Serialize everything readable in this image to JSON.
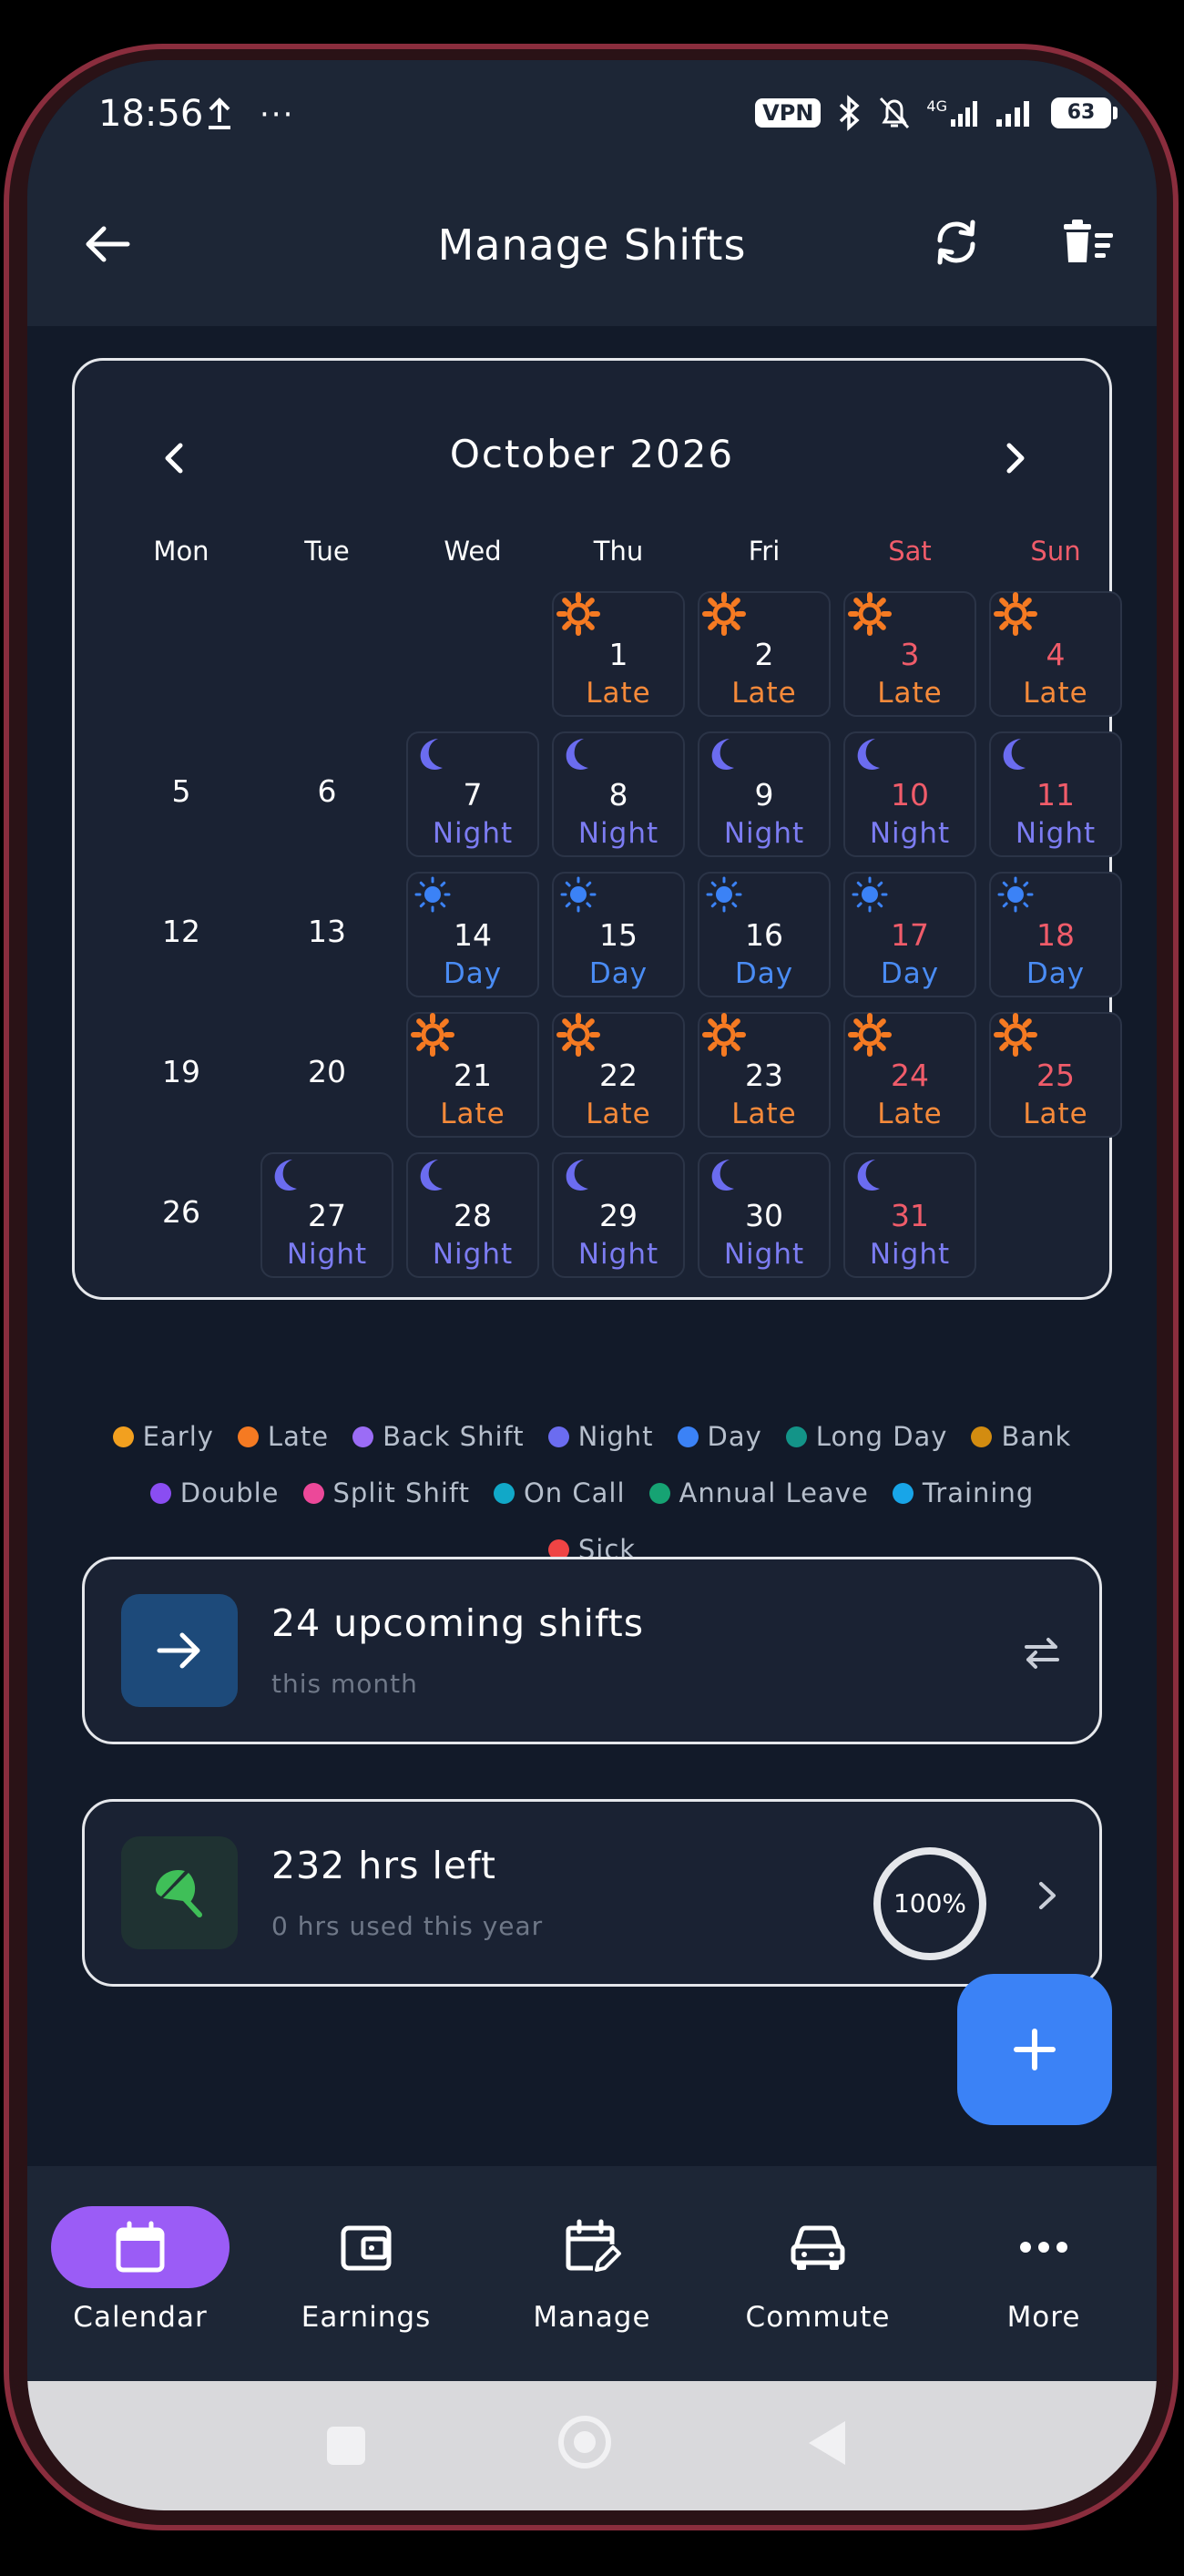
{
  "status_bar": {
    "time": "18:56",
    "vpn": "VPN",
    "network": "4G",
    "battery": "63"
  },
  "app_bar": {
    "title": "Manage Shifts"
  },
  "calendar": {
    "month_title": "October 2026",
    "weekdays": [
      "Mon",
      "Tue",
      "Wed",
      "Thu",
      "Fri",
      "Sat",
      "Sun"
    ],
    "weeks": [
      [
        null,
        null,
        null,
        {
          "day": "1",
          "shift": "Late"
        },
        {
          "day": "2",
          "shift": "Late"
        },
        {
          "day": "3",
          "shift": "Late"
        },
        {
          "day": "4",
          "shift": "Late"
        }
      ],
      [
        {
          "day": "5",
          "shift": null
        },
        {
          "day": "6",
          "shift": null
        },
        {
          "day": "7",
          "shift": "Night"
        },
        {
          "day": "8",
          "shift": "Night"
        },
        {
          "day": "9",
          "shift": "Night"
        },
        {
          "day": "10",
          "shift": "Night"
        },
        {
          "day": "11",
          "shift": "Night"
        }
      ],
      [
        {
          "day": "12",
          "shift": null
        },
        {
          "day": "13",
          "shift": null
        },
        {
          "day": "14",
          "shift": "Day"
        },
        {
          "day": "15",
          "shift": "Day"
        },
        {
          "day": "16",
          "shift": "Day"
        },
        {
          "day": "17",
          "shift": "Day"
        },
        {
          "day": "18",
          "shift": "Day"
        }
      ],
      [
        {
          "day": "19",
          "shift": null
        },
        {
          "day": "20",
          "shift": null
        },
        {
          "day": "21",
          "shift": "Late"
        },
        {
          "day": "22",
          "shift": "Late"
        },
        {
          "day": "23",
          "shift": "Late"
        },
        {
          "day": "24",
          "shift": "Late"
        },
        {
          "day": "25",
          "shift": "Late"
        }
      ],
      [
        {
          "day": "26",
          "shift": null
        },
        {
          "day": "27",
          "shift": "Night"
        },
        {
          "day": "28",
          "shift": "Night"
        },
        {
          "day": "29",
          "shift": "Night"
        },
        {
          "day": "30",
          "shift": "Night"
        },
        {
          "day": "31",
          "shift": "Night"
        },
        null
      ]
    ]
  },
  "legend": [
    [
      {
        "label": "Early",
        "color": "#f2a01f"
      },
      {
        "label": "Late",
        "color": "#f57a22"
      },
      {
        "label": "Back Shift",
        "color": "#9b6cf6"
      },
      {
        "label": "Night",
        "color": "#6b6cf0"
      },
      {
        "label": "Day",
        "color": "#3b82f6"
      },
      {
        "label": "Long Day",
        "color": "#139488"
      },
      {
        "label": "Bank",
        "color": "#d38c10"
      }
    ],
    [
      {
        "label": "Double",
        "color": "#8a4df2"
      },
      {
        "label": "Split Shift",
        "color": "#ec4899"
      },
      {
        "label": "On Call",
        "color": "#11a8c8"
      },
      {
        "label": "Annual Leave",
        "color": "#16a373"
      },
      {
        "label": "Training",
        "color": "#18a5e8"
      }
    ],
    [
      {
        "label": "Sick",
        "color": "#ef4444"
      }
    ]
  ],
  "upcoming_card": {
    "title": "24 upcoming shifts",
    "subtitle": "this month",
    "icon_bg": "#1d4a7a"
  },
  "leave_card": {
    "title": "232 hrs left",
    "subtitle": "0 hrs used this year",
    "progress_text": "100%",
    "progress": 1.0,
    "icon_bg": "#1f3232",
    "icon_color": "#3fbf58"
  },
  "colors": {
    "late": "#f57a22",
    "night": "#6b6cf0",
    "day": "#3b82f6",
    "weekend": "#f05c6a",
    "accent": "#9b5cf6",
    "fab": "#3b82f6"
  },
  "bottom_nav": [
    {
      "label": "Calendar",
      "icon": "calendar-icon",
      "active": true
    },
    {
      "label": "Earnings",
      "icon": "wallet-icon",
      "active": false
    },
    {
      "label": "Manage",
      "icon": "calendar-edit-icon",
      "active": false
    },
    {
      "label": "Commute",
      "icon": "car-icon",
      "active": false
    },
    {
      "label": "More",
      "icon": "more-icon",
      "active": false
    }
  ]
}
